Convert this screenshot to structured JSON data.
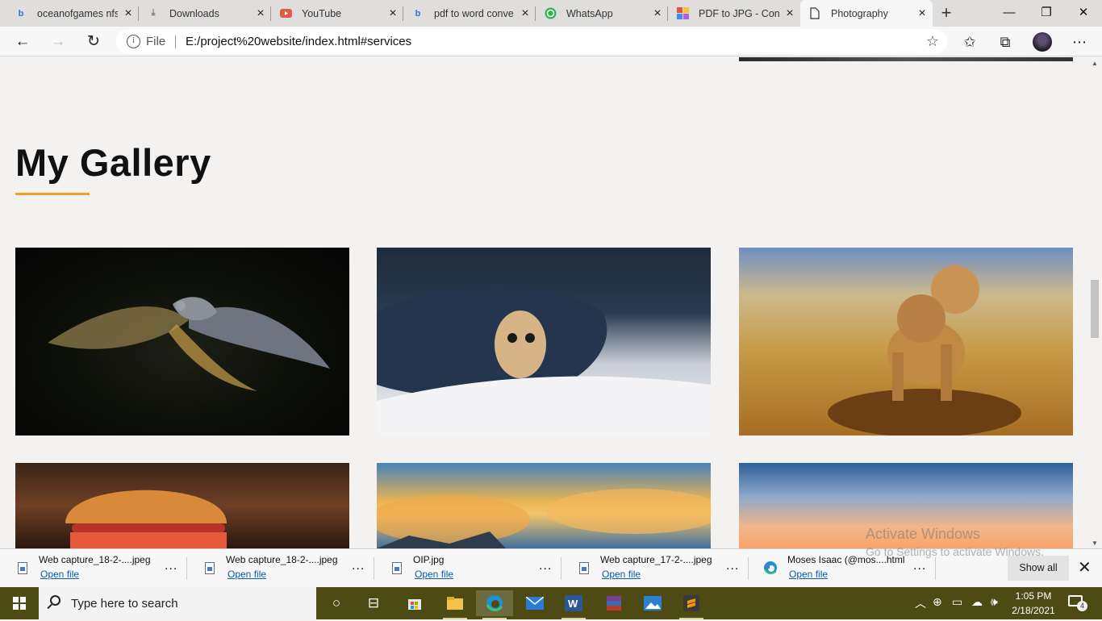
{
  "browser": {
    "tabs": [
      {
        "title": "oceanofgames nfs",
        "icon": "bing-icon",
        "color": "#3a6fd8"
      },
      {
        "title": "Downloads",
        "icon": "download-icon",
        "color": "#666666"
      },
      {
        "title": "YouTube",
        "icon": "youtube-icon",
        "color": "#e05a4f"
      },
      {
        "title": "pdf to word conve",
        "icon": "bing-icon",
        "color": "#3a6fd8"
      },
      {
        "title": "WhatsApp",
        "icon": "whatsapp-icon",
        "color": "#35b34a"
      },
      {
        "title": "PDF to JPG - Conv",
        "icon": "pdf-tools-icon",
        "color": "#e57f2a"
      },
      {
        "title": "Photography",
        "icon": "page-icon",
        "color": "#444444"
      }
    ],
    "address": {
      "scheme": "File",
      "url": "E:/project%20website/index.html#services"
    }
  },
  "page": {
    "heading": "My Gallery",
    "accent": "#f0a32a",
    "gallery": [
      {
        "subject": "pigeon in flight"
      },
      {
        "subject": "kitten under denim"
      },
      {
        "subject": "two lion cubs"
      },
      {
        "subject": "burger"
      },
      {
        "subject": "sunrise clouds"
      },
      {
        "subject": "sunset sky"
      }
    ]
  },
  "downloads": [
    {
      "file": "Web capture_18-2-....jpeg",
      "action": "Open file",
      "icon": "image-file-icon"
    },
    {
      "file": "Web capture_18-2-....jpeg",
      "action": "Open file",
      "icon": "image-file-icon"
    },
    {
      "file": "OIP.jpg",
      "action": "Open file",
      "icon": "image-file-icon"
    },
    {
      "file": "Web capture_17-2-....jpeg",
      "action": "Open file",
      "icon": "image-file-icon"
    },
    {
      "file": "Moses Isaac (@mos....html",
      "action": "Open file",
      "icon": "edge-icon"
    }
  ],
  "download_bar": {
    "show_all": "Show all",
    "more": "..."
  },
  "watermark": {
    "line1": "Activate Windows",
    "line2": "Go to Settings to activate Windows."
  },
  "taskbar": {
    "search_placeholder": "Type here to search",
    "time": "1:05 PM",
    "date": "2/18/2021",
    "notification_count": "4"
  }
}
